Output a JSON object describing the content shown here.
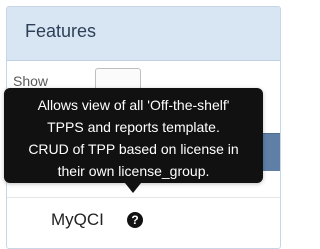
{
  "panel": {
    "title": "Features"
  },
  "controls": {
    "show_label": "Show"
  },
  "row": {
    "label": "MyQCI"
  },
  "icons": {
    "help": "?"
  },
  "tooltip": {
    "lines": [
      "Allows view of all 'Off-the-shelf'",
      "TPPS and reports template.",
      "CRUD of TPP based on license in",
      "their own license_group."
    ]
  },
  "colors": {
    "header_bg": "#d8e6f3",
    "table_head_bg": "#5f7fa6",
    "tooltip_bg": "#111111"
  }
}
